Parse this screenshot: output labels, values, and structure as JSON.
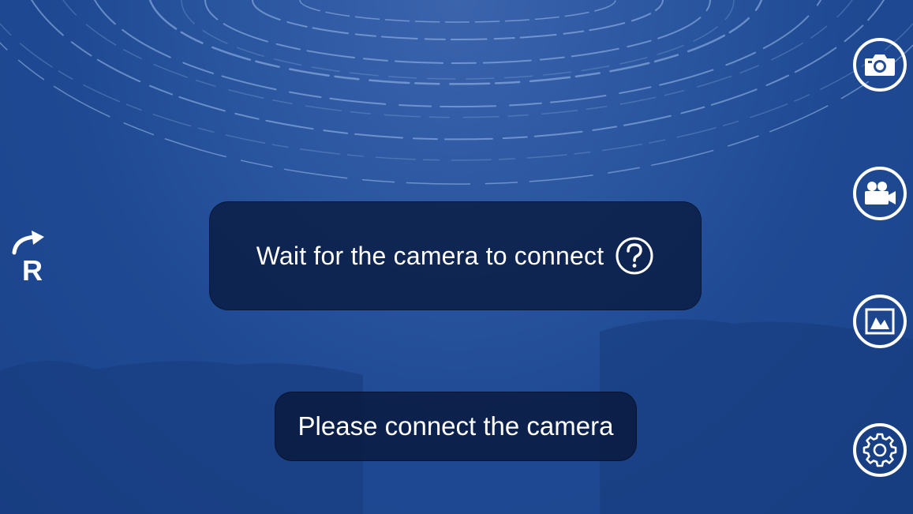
{
  "status": {
    "message": "Wait for the camera to connect"
  },
  "connect_button": {
    "label": "Please connect the camera"
  },
  "icons": {
    "rotate": "rotate-r-icon",
    "help": "question-circle-icon",
    "photo": "camera-icon",
    "video": "video-camera-icon",
    "gallery": "gallery-icon",
    "settings": "gear-icon"
  },
  "colors": {
    "background": "#1f4a93",
    "panel": "#08183c",
    "text": "#ffffff"
  }
}
